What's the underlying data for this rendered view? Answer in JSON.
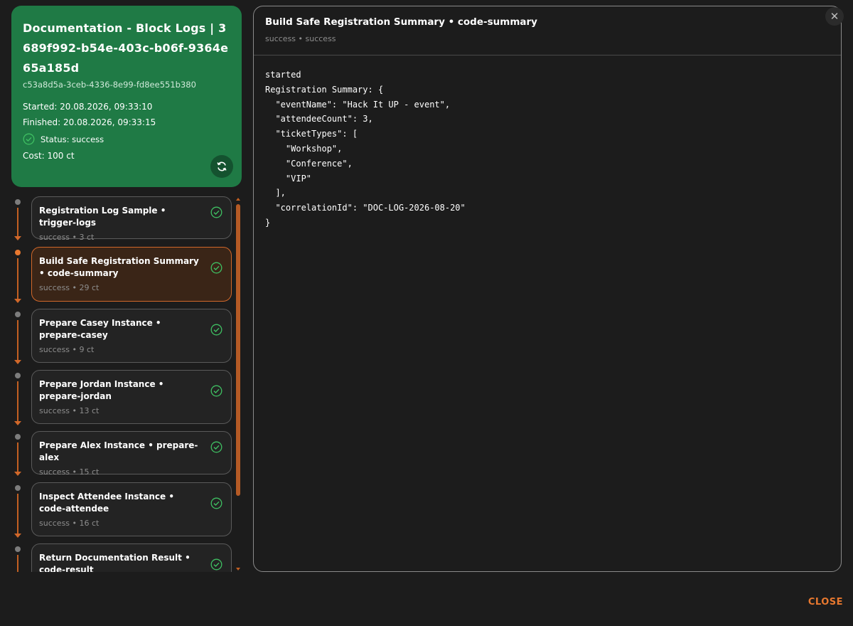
{
  "summary": {
    "title": "Documentation - Block Logs | 3689f992-b54e-403c-b06f-9364e65a185d",
    "id": "c53a8d5a-3ceb-4336-8e99-fd8ee551b380",
    "started": "Started: 20.08.2026, 09:33:10",
    "finished": "Finished: 20.08.2026, 09:33:15",
    "status": "Status: success",
    "cost": "Cost: 100 ct"
  },
  "steps": [
    {
      "title": "Registration Log Sample • trigger-logs",
      "sub": "success • 3 ct",
      "active": false
    },
    {
      "title": "Build Safe Registration Summary • code-summary",
      "sub": "success • 29 ct",
      "active": true
    },
    {
      "title": "Prepare Casey Instance • prepare-casey",
      "sub": "success • 9 ct",
      "active": false
    },
    {
      "title": "Prepare Jordan Instance • prepare-jordan",
      "sub": "success • 13 ct",
      "active": false
    },
    {
      "title": "Prepare Alex Instance • prepare-alex",
      "sub": "success • 15 ct",
      "active": false
    },
    {
      "title": "Inspect Attendee Instance • code-attendee",
      "sub": "success • 16 ct",
      "active": false
    },
    {
      "title": "Return Documentation Result • code-result",
      "sub": "",
      "active": false
    }
  ],
  "detail": {
    "title": "Build Safe Registration Summary • code-summary",
    "sub": "success • success",
    "log": "started\nRegistration Summary: {\n  \"eventName\": \"Hack It UP - event\",\n  \"attendeeCount\": 3,\n  \"ticketTypes\": [\n    \"Workshop\",\n    \"Conference\",\n    \"VIP\"\n  ],\n  \"correlationId\": \"DOC-LOG-2026-08-20\"\n}"
  },
  "actions": {
    "close_label": "CLOSE",
    "close_x": "✕"
  },
  "icons": {
    "status": "check-circle-icon",
    "refresh": "refresh-icon"
  },
  "colors": {
    "accent": "#e8782f",
    "success": "#1f7a45",
    "check": "#2ea84f"
  }
}
